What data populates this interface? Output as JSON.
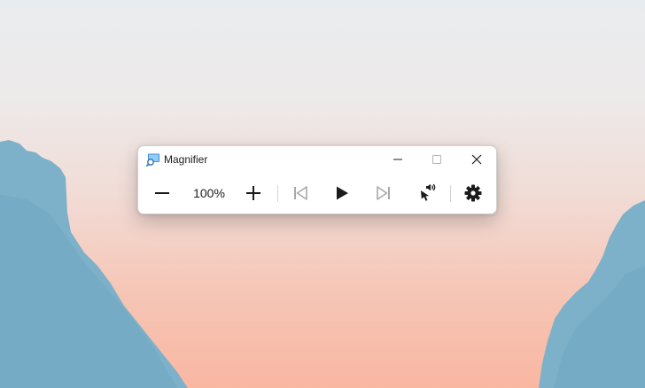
{
  "window": {
    "title": "Magnifier",
    "app_icon": "magnifier-app-icon"
  },
  "caption_buttons": {
    "minimize": "minimize-icon",
    "maximize": "maximize-icon",
    "maximize_state": "disabled",
    "close": "close-icon"
  },
  "toolbar": {
    "zoom_out_icon": "minus-icon",
    "zoom_level": "100%",
    "zoom_in_icon": "plus-icon",
    "previous_paragraph_icon": "skip-previous-icon",
    "previous_paragraph_state": "disabled",
    "play_icon": "play-icon",
    "next_paragraph_icon": "skip-next-icon",
    "next_paragraph_state": "disabled",
    "read_from_here_icon": "pointer-speaker-icon",
    "settings_icon": "gear-icon"
  },
  "colors": {
    "sky_top": "#e9ecef",
    "sky_bottom": "#f9b7a2",
    "cliff": "#7bb0c9",
    "window_bg": "#ffffff",
    "icon_active": "#1b1b1b",
    "icon_disabled": "#a0a0a0"
  }
}
